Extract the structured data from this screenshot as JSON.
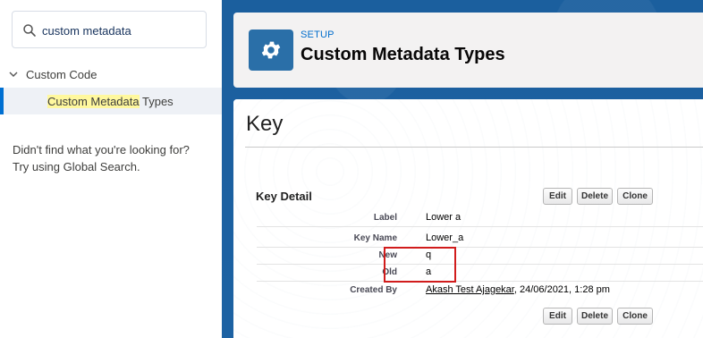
{
  "sidebar": {
    "search_value": "custom metadata",
    "tree": {
      "parent_label": "Custom Code",
      "child_label_highlight": "Custom Metadata",
      "child_label_rest": " Types"
    },
    "help_line1": "Didn't find what you're looking for?",
    "help_line2": "Try using Global Search."
  },
  "header": {
    "breadcrumb": "SETUP",
    "title": "Custom Metadata Types",
    "icon": "gear-icon"
  },
  "record": {
    "title": "Key",
    "section_title": "Key Detail",
    "buttons": {
      "edit": "Edit",
      "delete": "Delete",
      "clone": "Clone"
    },
    "fields": [
      {
        "label": "Label",
        "value": "Lower a"
      },
      {
        "label": "Key Name",
        "value": "Lower_a"
      },
      {
        "label": "New",
        "value": "q"
      },
      {
        "label": "Old",
        "value": "a"
      },
      {
        "label": "Created By",
        "value_link": "Akash Test Ajagekar",
        "value_rest": ", 24/06/2021, 1:28 pm"
      }
    ]
  },
  "colors": {
    "brand_blue": "#1b5f9e",
    "accent": "#0070d2",
    "highlight": "#fff89e",
    "annotation_red": "#d11c1c"
  }
}
